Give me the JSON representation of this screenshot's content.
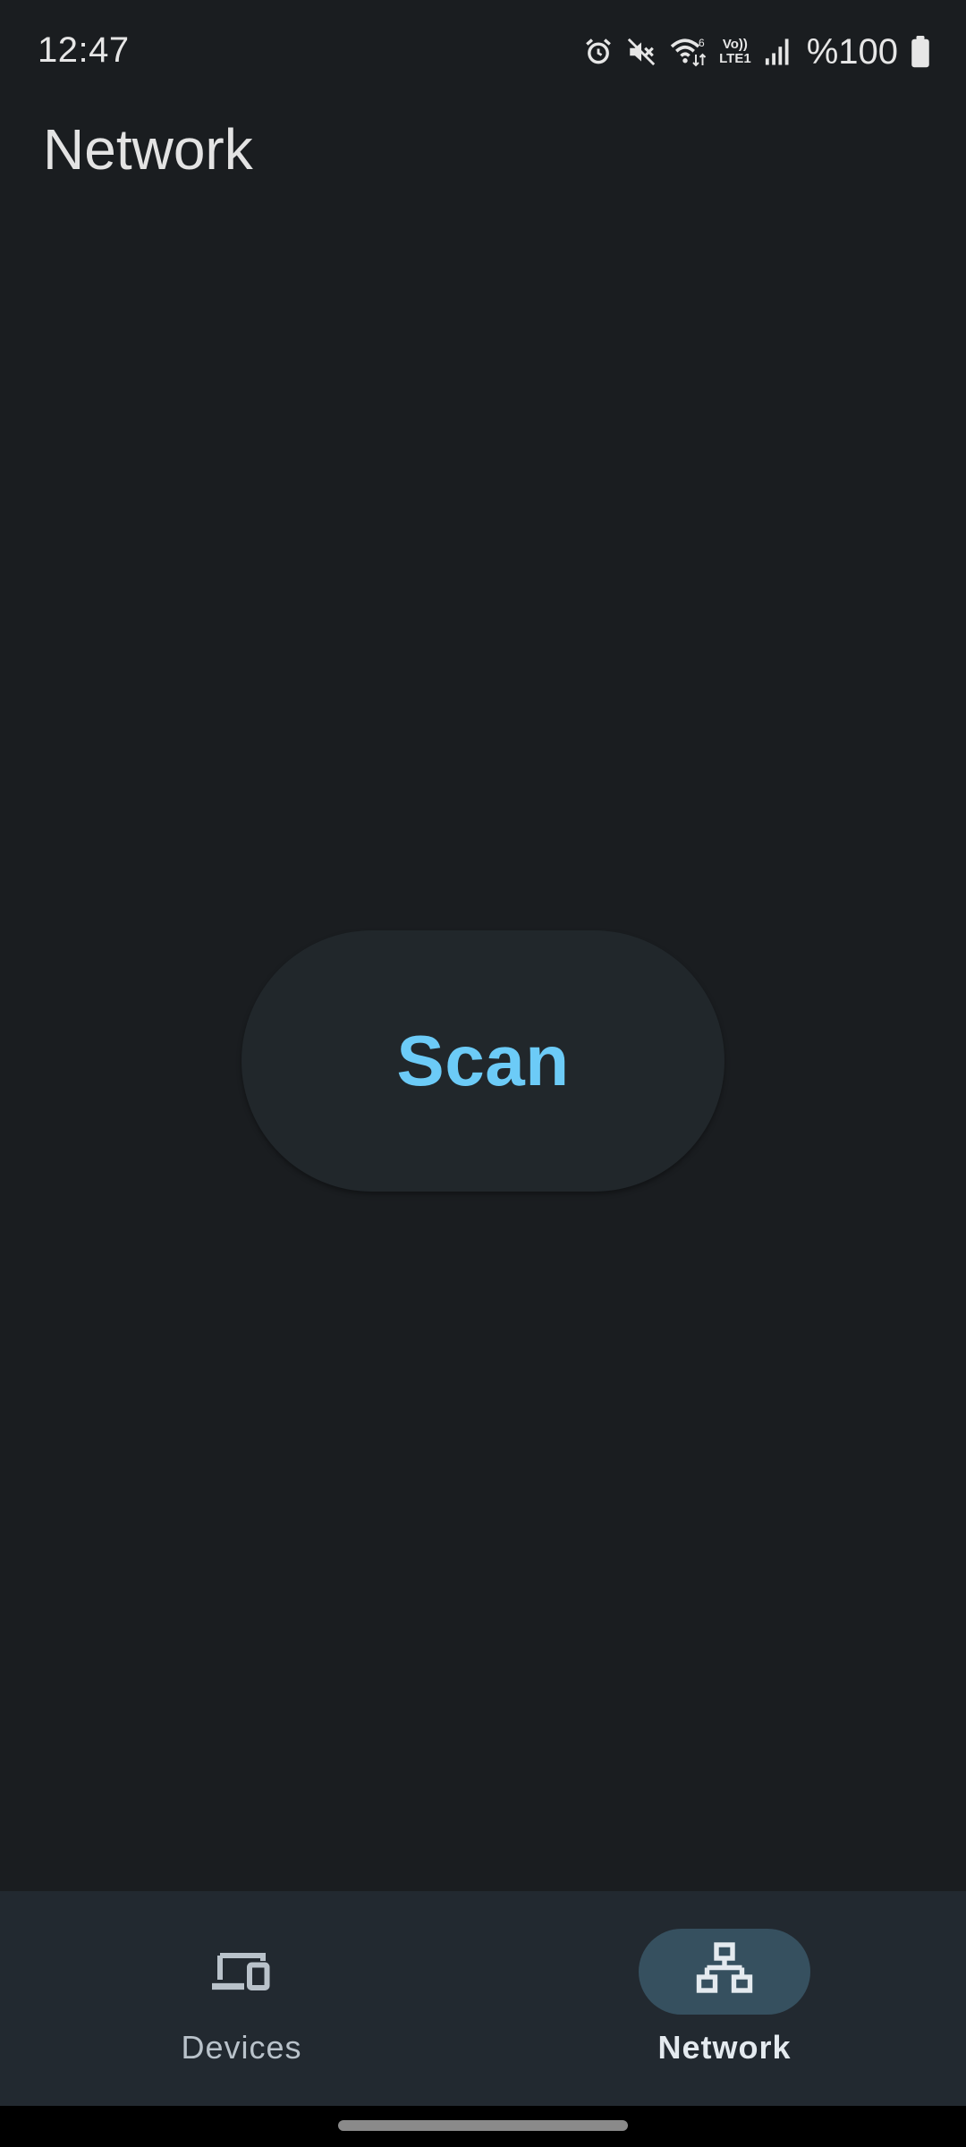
{
  "status_bar": {
    "time": "12:47",
    "lte_top": "Vo))",
    "lte_bottom": "LTE1",
    "battery": "%100",
    "icons": [
      "alarm-icon",
      "mute-icon",
      "wifi-icon",
      "volte-icon",
      "signal-icon",
      "battery-icon"
    ]
  },
  "header": {
    "title": "Network"
  },
  "main": {
    "scan_label": "Scan"
  },
  "bottom_nav": {
    "items": [
      {
        "label": "Devices",
        "icon": "devices-icon",
        "selected": false
      },
      {
        "label": "Network",
        "icon": "network-icon",
        "selected": true
      }
    ]
  },
  "colors": {
    "background": "#1a1d20",
    "accent": "#6ccbf7",
    "nav_background": "#222930",
    "nav_active_pill": "#36505f"
  }
}
